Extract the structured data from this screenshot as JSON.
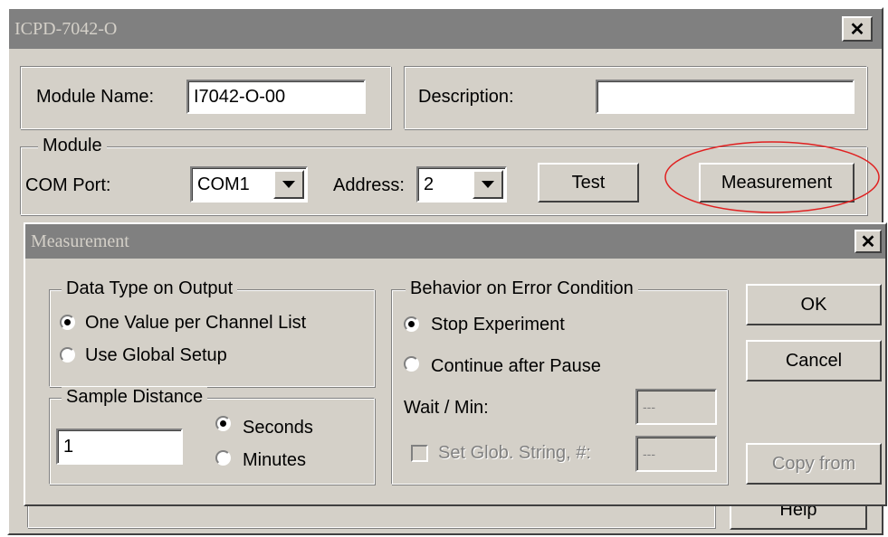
{
  "main_window": {
    "title": "ICPD-7042-O",
    "close_glyph": "✕",
    "module_name_label": "Module Name:",
    "module_name_value": "I7042-O-00",
    "description_label": "Description:",
    "description_value": "",
    "module_group_label": "Module",
    "com_port_label": "COM Port:",
    "com_port_value": "COM1",
    "address_label": "Address:",
    "address_value": "2",
    "test_button": "Test",
    "measurement_button": "Measurement",
    "help_button": "Help",
    "highlight_color": "#e02020"
  },
  "dialog": {
    "title": "Measurement",
    "close_glyph": "✕",
    "data_type_group": "Data Type on Output",
    "data_type_options": [
      "One Value per Channel List",
      "Use Global Setup"
    ],
    "data_type_selected": 0,
    "sample_distance_group": "Sample Distance",
    "sample_distance_value": "1",
    "sample_unit_options": [
      "Seconds",
      "Minutes"
    ],
    "sample_unit_selected": 0,
    "error_group": "Behavior on Error Condition",
    "error_options": [
      "Stop Experiment",
      "Continue after Pause"
    ],
    "error_selected": 0,
    "wait_label": "Wait / Min:",
    "wait_value": "---",
    "set_glob_label": "Set Glob. String, #:",
    "set_glob_value": "---",
    "ok_button": "OK",
    "cancel_button": "Cancel",
    "copy_from_button": "Copy from"
  }
}
